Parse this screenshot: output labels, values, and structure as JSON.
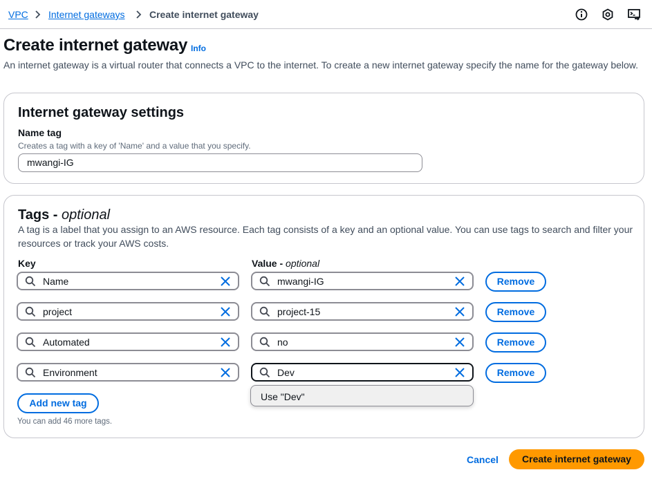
{
  "breadcrumb": {
    "items": [
      "VPC",
      "Internet gateways",
      "Create internet gateway"
    ]
  },
  "top_icons": [
    "info-circle-icon",
    "settings-hex-icon",
    "cloudshell-icon"
  ],
  "page": {
    "title": "Create internet gateway",
    "info_label": "Info",
    "description": "An internet gateway is a virtual router that connects a VPC to the internet. To create a new internet gateway specify the name for the gateway below."
  },
  "settings": {
    "title": "Internet gateway settings",
    "name_tag_label": "Name tag",
    "name_tag_hint": "Creates a tag with a key of 'Name' and a value that you specify.",
    "name_tag_value": "mwangi-IG"
  },
  "tags": {
    "title": "Tags - ",
    "title_optional": "optional",
    "description": "A tag is a label that you assign to an AWS resource. Each tag consists of a key and an optional value. You can use tags to search and filter your resources or track your AWS costs.",
    "key_label": "Key",
    "value_label": "Value - ",
    "value_optional": "optional",
    "rows": [
      {
        "key": "Name",
        "value": "mwangi-IG",
        "remove_label": "Remove"
      },
      {
        "key": "project",
        "value": "project-15",
        "remove_label": "Remove"
      },
      {
        "key": "Automated",
        "value": "no",
        "remove_label": "Remove"
      },
      {
        "key": "Environment",
        "value": "Dev",
        "remove_label": "Remove"
      }
    ],
    "suggestion": "Use \"Dev\"",
    "add_label": "Add new tag",
    "limit_hint": "You can add 46 more tags."
  },
  "actions": {
    "cancel_label": "Cancel",
    "submit_label": "Create internet gateway"
  },
  "colors": {
    "link": "#006ce0",
    "primary_button": "#ff9900",
    "border": "#8c8c94"
  }
}
